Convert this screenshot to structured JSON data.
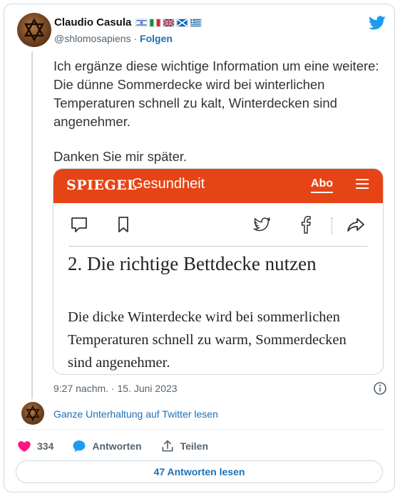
{
  "author": {
    "name": "Claudio Casula",
    "handle": "@shlomosapiens",
    "separator": "·",
    "follow_label": "Folgen",
    "flags": [
      "israel-flag",
      "italy-flag",
      "uk-flag",
      "scotland-flag",
      "greece-flag"
    ]
  },
  "tweet": {
    "paragraph1": "Ich ergänze diese wichtige Information um eine weitere: Die dünne Sommerdecke wird bei winterlichen Temperaturen schnell zu kalt, Winterdecken sind angenehmer.",
    "paragraph2": "Danken Sie mir später.",
    "timestamp": "9:27 nachm. · 15. Juni 2023"
  },
  "media": {
    "logo": "SPIEGEL",
    "section": "Gesundheit",
    "abo_label": "Abo",
    "article_title": "2. Die richtige Bettdecke nutzen",
    "article_body": "Die dicke Winterdecke wird bei sommerlichen Temperaturen schnell zu warm, Sommerdecken sind angenehmer.",
    "brand_color": "#e64415"
  },
  "conversation": {
    "link_label": "Ganze Unterhaltung auf Twitter lesen"
  },
  "actions": {
    "like_count": "334",
    "reply_label": "Antworten",
    "share_label": "Teilen"
  },
  "footer": {
    "replies_button": "47 Antworten lesen"
  },
  "colors": {
    "twitter_blue": "#1d9bf0",
    "link_blue": "#1d6fb8",
    "heart_pink": "#f91880"
  }
}
